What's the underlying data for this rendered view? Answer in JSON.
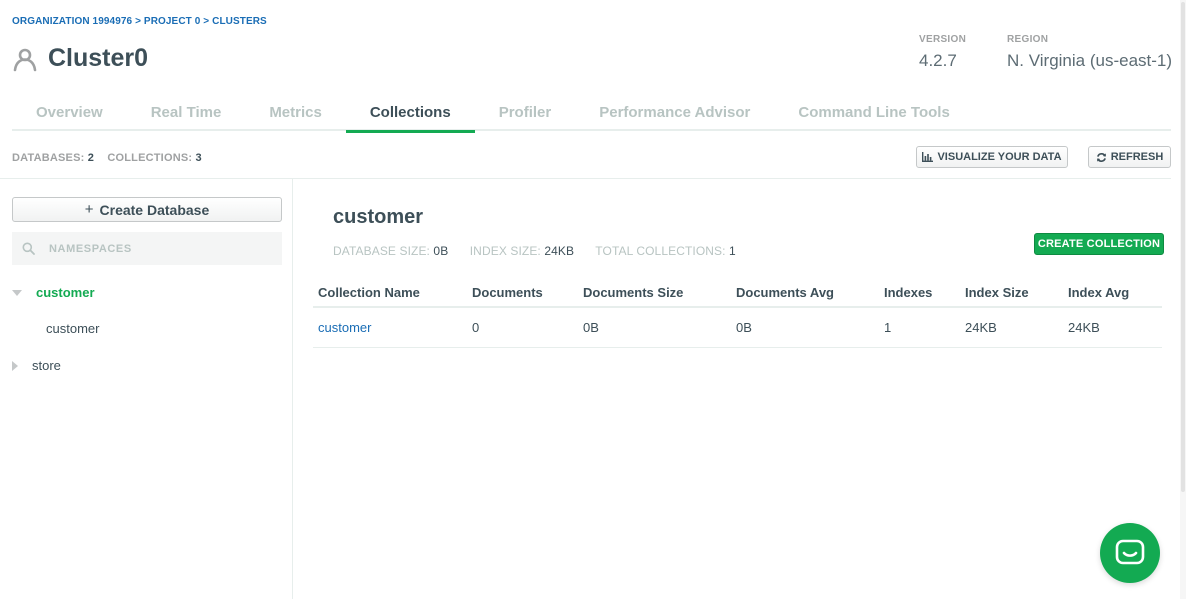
{
  "breadcrumb": {
    "org": "ORGANIZATION 1994976",
    "sep1": ">",
    "project": "PROJECT 0",
    "sep2": ">",
    "clusters": "CLUSTERS"
  },
  "cluster": {
    "name": "Cluster0",
    "icon": "cluster-person-icon"
  },
  "meta": {
    "version_label": "VERSION",
    "version_value": "4.2.7",
    "region_label": "REGION",
    "region_value": "N. Virginia (us-east-1)"
  },
  "tabs": [
    {
      "label": "Overview",
      "active": false
    },
    {
      "label": "Real Time",
      "active": false
    },
    {
      "label": "Metrics",
      "active": false
    },
    {
      "label": "Collections",
      "active": true
    },
    {
      "label": "Profiler",
      "active": false
    },
    {
      "label": "Performance Advisor",
      "active": false
    },
    {
      "label": "Command Line Tools",
      "active": false
    }
  ],
  "stats": {
    "databases_label": "DATABASES:",
    "databases_value": "2",
    "collections_label": "COLLECTIONS:",
    "collections_value": "3"
  },
  "toolbar": {
    "visualize_label": "VISUALIZE YOUR DATA",
    "refresh_label": "REFRESH"
  },
  "sidebar": {
    "create_db_label": "Create Database",
    "search_placeholder": "NAMESPACES",
    "databases": [
      {
        "name": "customer",
        "expanded": true,
        "collections": [
          "customer"
        ]
      },
      {
        "name": "store",
        "expanded": false,
        "collections": []
      }
    ]
  },
  "main": {
    "db_name": "customer",
    "db_size_label": "DATABASE SIZE:",
    "db_size_value": "0B",
    "index_size_label": "INDEX SIZE:",
    "index_size_value": "24KB",
    "total_coll_label": "TOTAL COLLECTIONS:",
    "total_coll_value": "1",
    "create_collection_label": "CREATE COLLECTION",
    "table": {
      "headers": [
        "Collection Name",
        "Documents",
        "Documents Size",
        "Documents Avg",
        "Indexes",
        "Index Size",
        "Index Avg"
      ],
      "rows": [
        [
          "customer",
          "0",
          "0B",
          "0B",
          "1",
          "24KB",
          "24KB"
        ]
      ]
    }
  },
  "colors": {
    "accent_green": "#13aa52",
    "link_blue": "#1a6db5",
    "text_dark": "#3d4f58",
    "text_muted": "#b8c4c2"
  }
}
